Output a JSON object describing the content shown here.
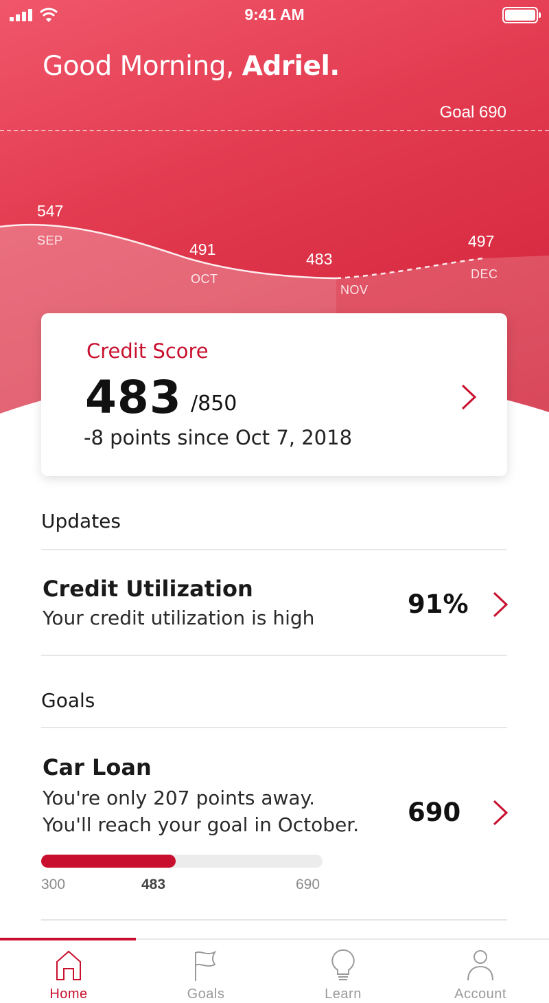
{
  "status_bar": {
    "time": "9:41 AM"
  },
  "header": {
    "greeting": "Good Morning,",
    "name": "Adriel."
  },
  "score_chart": {
    "goal_label": "Goal 690",
    "points": [
      {
        "month": "SEP",
        "value": "547"
      },
      {
        "month": "OCT",
        "value": "491"
      },
      {
        "month": "NOV",
        "value": "483"
      },
      {
        "month": "DEC",
        "value": "497"
      }
    ]
  },
  "credit_card": {
    "title": "Credit Score",
    "score": "483",
    "max": "/850",
    "change": "-8 points since Oct 7, 2018"
  },
  "updates": {
    "title": "Updates",
    "item": {
      "title": "Credit Utilization",
      "subtitle": "Your credit utilization is high",
      "value": "91%"
    }
  },
  "goals": {
    "title": "Goals",
    "item": {
      "title": "Car Loan",
      "line1": "You're only 207 points away.",
      "line2": "You'll reach your goal in October.",
      "value": "690",
      "progress": {
        "min": "300",
        "current": "483",
        "max": "690",
        "fraction": 0.478
      }
    }
  },
  "tabs": [
    {
      "label": "Home",
      "icon": "home-icon",
      "active": true
    },
    {
      "label": "Goals",
      "icon": "flag-icon",
      "active": false
    },
    {
      "label": "Learn",
      "icon": "lightbulb-icon",
      "active": false
    },
    {
      "label": "Account",
      "icon": "person-icon",
      "active": false
    }
  ],
  "colors": {
    "accent": "#c8102e",
    "hero_start": "#f0566a",
    "hero_end": "#cf1f36"
  }
}
